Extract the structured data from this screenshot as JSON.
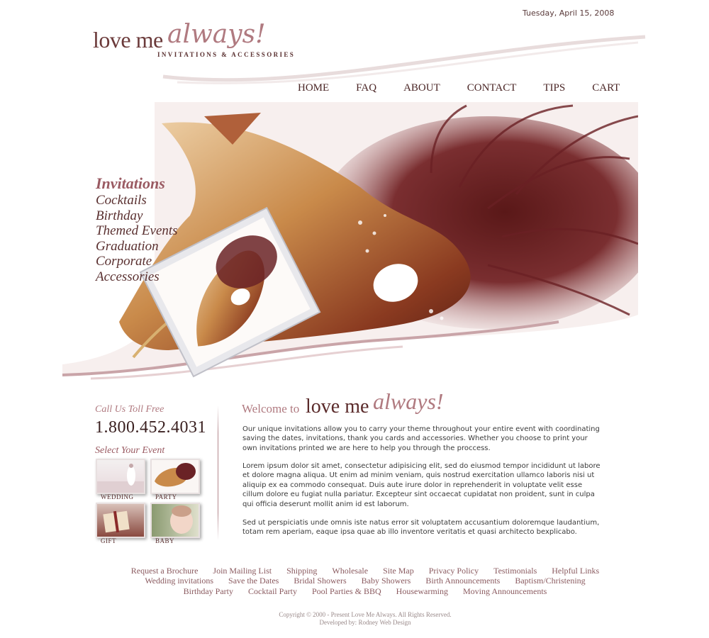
{
  "header": {
    "date": "Tuesday, April 15, 2008",
    "logo_main": "love me",
    "logo_script": "always!",
    "logo_tagline": "INVITATIONS  &  ACCESSORIES"
  },
  "nav": [
    "HOME",
    "FAQ",
    "ABOUT",
    "CONTACT",
    "TIPS",
    "CART"
  ],
  "events": [
    "Invitations",
    "Cocktails",
    "Birthday",
    "Themed Events",
    "Graduation",
    "Corporate",
    "Accessories"
  ],
  "contact": {
    "call_label": "Call Us Toll Free",
    "phone": "1.800.452.4031"
  },
  "select_event": {
    "title": "Select Your Event",
    "items": [
      "WEDDING",
      "PARTY",
      "GIFT",
      "BABY"
    ]
  },
  "welcome": {
    "prefix": "Welcome to",
    "main": "love me",
    "script": "always!",
    "p1": "Our unique invitations allow you to carry your theme throughout your entire event with coordinating saving the dates, invitations, thank you cards and accessories. Whether you choose to print your own invitations printed we are here to help you through the proccess.",
    "p2": "Lorem ipsum dolor sit amet, consectetur adipisicing elit, sed do eiusmod tempor incididunt ut labore et dolore magna aliqua. Ut enim ad minim veniam, quis nostrud exercitation ullamco laboris nisi ut aliquip ex ea commodo consequat. Duis aute irure dolor in reprehenderit in voluptate velit esse cillum dolore eu fugiat nulla pariatur. Excepteur sint occaecat cupidatat non proident, sunt in culpa qui officia deserunt mollit anim id est laborum.",
    "p3": "Sed ut perspiciatis unde omnis iste natus error sit voluptatem accusantium doloremque laudantium, totam rem aperiam, eaque ipsa quae ab illo inventore veritatis et quasi architecto bexplicabo."
  },
  "footer": {
    "row1": [
      "Request a Brochure",
      "Join Mailing List",
      "Shipping",
      "Wholesale",
      "Site Map",
      "Privacy Policy",
      "Testimonials",
      "Helpful Links"
    ],
    "row2": [
      "Wedding invitations",
      "Save the Dates",
      "Bridal Showers",
      "Baby Showers",
      "Birth Announcements",
      "Baptism/Christening"
    ],
    "row3": [
      "Birthday Party",
      "Cocktail Party",
      "Pool Parties & BBQ",
      "Housewarming",
      "Moving Announcements"
    ],
    "copyright": "Copyright © 2000 - Present Love Me Always. All Rights Reserved.",
    "developer": "Developed by: Rodney Web Design"
  },
  "colors": {
    "brand_dark": "#5a2a2a",
    "brand_rose": "#b07a80",
    "link": "#8a5a5f"
  }
}
